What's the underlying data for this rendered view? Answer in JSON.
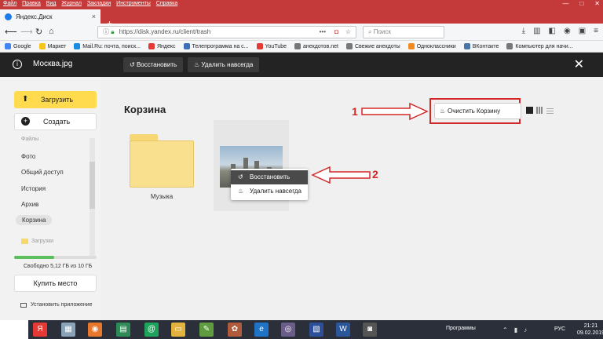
{
  "titlebar": {
    "menu": [
      "Файл",
      "Правка",
      "Вид",
      "Журнал",
      "Закладки",
      "Инструменты",
      "Справка"
    ],
    "minimize": "—",
    "maximize": "□",
    "close": "✕"
  },
  "tab": {
    "title": "Яндекс.Диск",
    "close": "×",
    "new_tab": "+"
  },
  "navbar": {
    "url": "https://disk.yandex.ru/client/trash",
    "search_placeholder": "Поиск",
    "dots": "•••"
  },
  "bookmarks": [
    {
      "label": "Google",
      "color": "#4285f4"
    },
    {
      "label": "Маркет",
      "color": "#f5c518"
    },
    {
      "label": "Mail.Ru: почта, поиск...",
      "color": "#168de2"
    },
    {
      "label": "Яндекс",
      "color": "#e53935"
    },
    {
      "label": "Телепрограмма на с...",
      "color": "#3b6fb6"
    },
    {
      "label": "YouTube",
      "color": "#e53935"
    },
    {
      "label": "анекдотов.net",
      "color": "#777777"
    },
    {
      "label": "Свежие анекдоты",
      "color": "#777777"
    },
    {
      "label": "Одноклассники",
      "color": "#f28a20"
    },
    {
      "label": "ВКонтакте",
      "color": "#4a76a8"
    },
    {
      "label": "Компьютер для начи...",
      "color": "#777777"
    }
  ],
  "viewer": {
    "info_icon": "i",
    "filename": "Москва.jpg",
    "restore": "Восстановить",
    "delete_forever": "Удалить навсегда",
    "close": "✕"
  },
  "sidebar": {
    "upload": "Загрузить",
    "create": "Создать",
    "files": "Файлы",
    "items": [
      "Фото",
      "Общий доступ",
      "История",
      "Архив",
      "Корзина"
    ],
    "downloads": "Загрузки",
    "quota_fraction": 0.49,
    "quota_text": "Свободно 5,12 ГБ из 10 ГБ",
    "buy": "Купить место",
    "install_app": "Установить приложение"
  },
  "main": {
    "title": "Корзина",
    "clear_trash": "Очистить Корзину",
    "folder_name": "Музыка"
  },
  "context_menu": {
    "restore": "Восстановить",
    "delete_forever": "Удалить навсегда"
  },
  "annotations": {
    "one": "1",
    "two": "2"
  },
  "colors": {
    "browser_red": "#c43a3a",
    "upload_yellow": "#ffdb4d",
    "annotation_red": "#d32828",
    "viewer_dark": "#232323"
  },
  "taskbar": {
    "programs": "Программы",
    "lang": "РУС",
    "time": "21:21",
    "date": "09.02.2019"
  }
}
